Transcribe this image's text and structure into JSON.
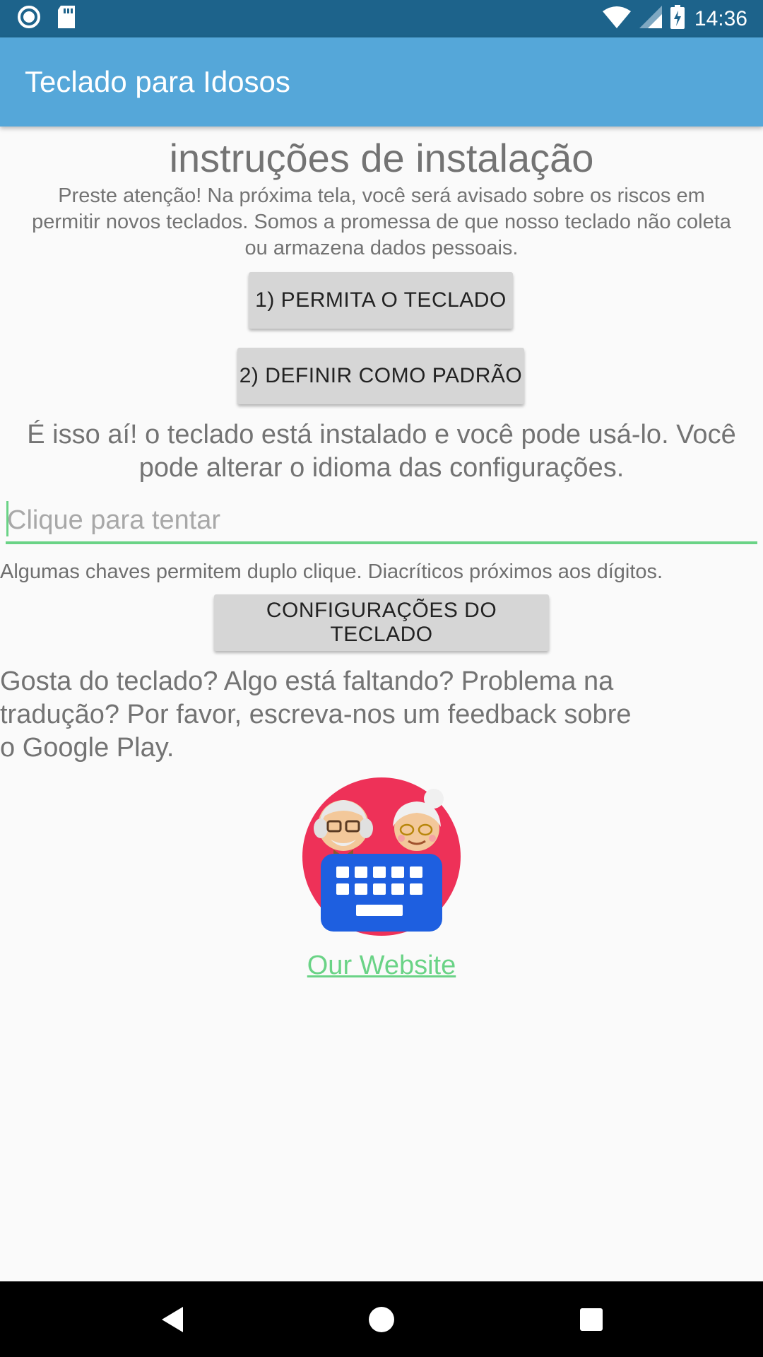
{
  "status_bar": {
    "time": "14:36",
    "icons": [
      "record-icon",
      "sd-card-icon",
      "wifi-icon",
      "signal-icon",
      "battery-charging-icon"
    ]
  },
  "app_bar": {
    "title": "Teclado para Idosos"
  },
  "main": {
    "heading": "instruções de instalação",
    "warning": "Preste atenção! Na próxima tela, você será avisado sobre os riscos em permitir novos teclados. Somos a promessa de que nosso teclado não coleta ou armazena dados pessoais.",
    "button_allow": "1) PERMITA O TECLADO",
    "button_default": "2) DEFINIR COMO PADRÃO",
    "installed_text": "É isso aí! o teclado está instalado e você pode usá-lo. Você pode alterar o idioma das configurações.",
    "try_field": {
      "placeholder": "Clique para tentar",
      "value": ""
    },
    "hint": "Algumas chaves permitem duplo clique. Diacríticos próximos aos dígitos.",
    "button_settings": "CONFIGURAÇÕES DO TECLADO",
    "feedback": "Gosta do teclado? Algo está faltando? Problema na tradução? Por favor, escreva-nos um feedback sobre o Google Play.",
    "website_link": "Our Website"
  },
  "nav_bar": {
    "buttons": [
      "back-icon",
      "home-icon",
      "recents-icon"
    ]
  },
  "colors": {
    "status_bar": "#1d638b",
    "app_bar": "#55a7d9",
    "accent": "#6ad386",
    "button": "#d6d6d6",
    "logo_circle": "#ee3158",
    "logo_keyboard": "#1e5fe0"
  }
}
